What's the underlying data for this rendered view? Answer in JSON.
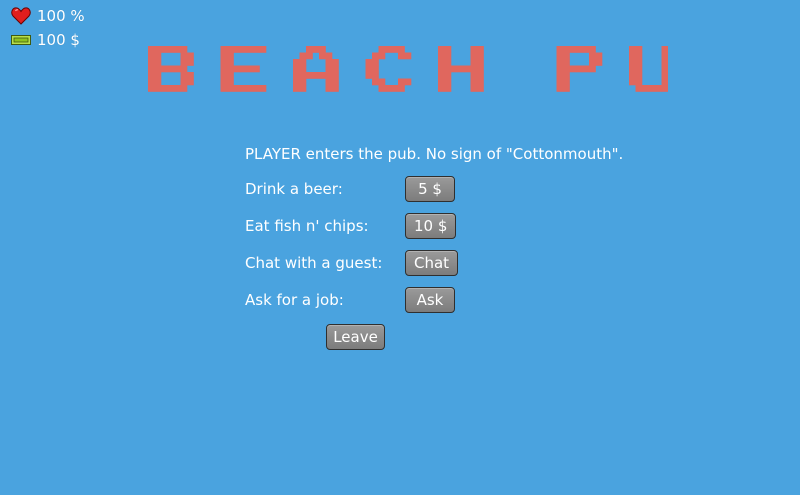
{
  "hud": {
    "health": "100 %",
    "money": "100 $",
    "health_icon": "heart-icon",
    "money_icon": "banknote-icon"
  },
  "title": "BEACH PUB",
  "title_color": "#e0675e",
  "background_color": "#4aa3df",
  "intro": "PLAYER enters the pub. No sign of \"Cottonmouth\".",
  "actions": [
    {
      "label": "Drink a beer:",
      "button": "5 $"
    },
    {
      "label": "Eat fish n' chips:",
      "button": "10 $"
    },
    {
      "label": "Chat with a guest:",
      "button": "Chat"
    },
    {
      "label": "Ask for a job:",
      "button": "Ask"
    }
  ],
  "leave_button": "Leave"
}
